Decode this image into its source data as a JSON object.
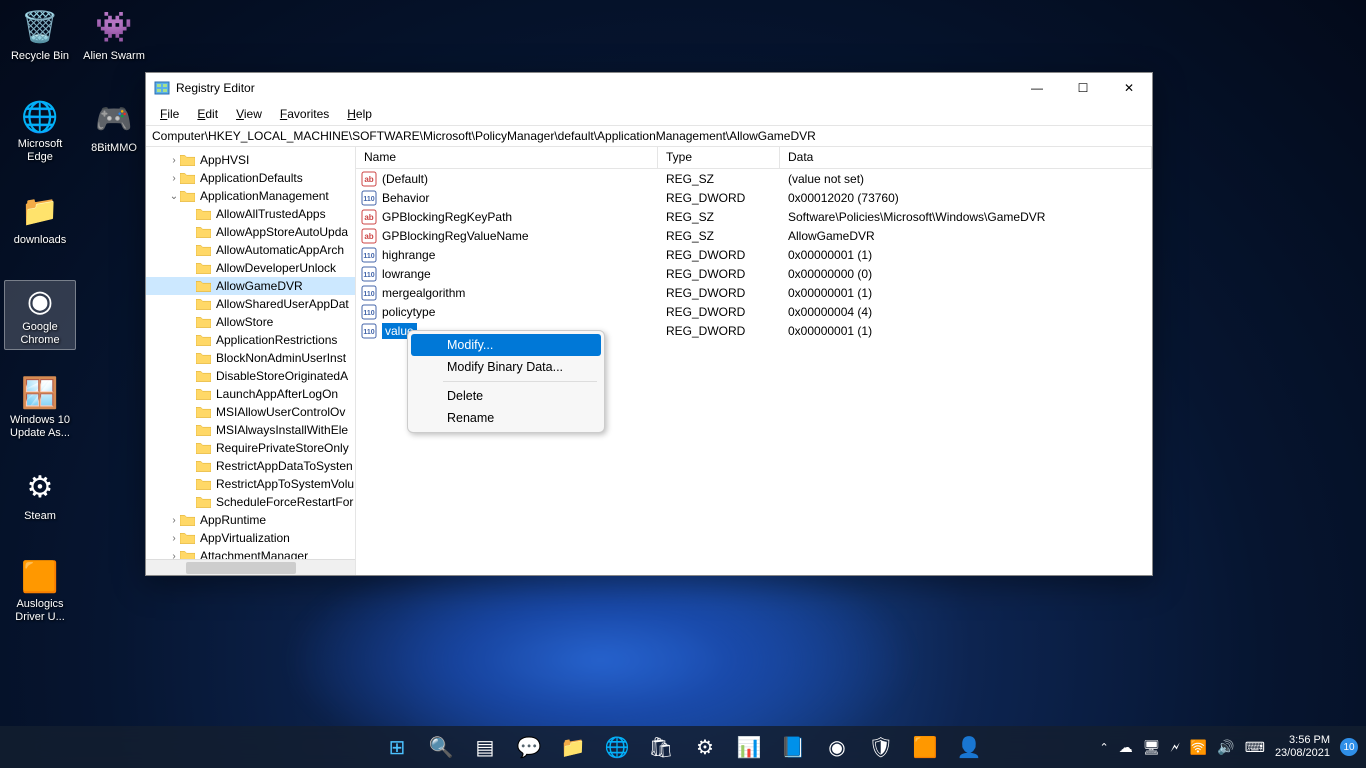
{
  "desktop": {
    "col1": [
      {
        "name": "recycle-bin",
        "label": "Recycle Bin",
        "glyph": "🗑️"
      },
      {
        "name": "edge",
        "label": "Microsoft Edge",
        "glyph": "🌐"
      },
      {
        "name": "downloads",
        "label": "downloads",
        "glyph": "📁"
      },
      {
        "name": "chrome",
        "label": "Google Chrome",
        "glyph": "◉",
        "selected": true
      },
      {
        "name": "win10update",
        "label": "Windows 10 Update As...",
        "glyph": "🪟"
      },
      {
        "name": "steam",
        "label": "Steam",
        "glyph": "⚙"
      },
      {
        "name": "auslogics",
        "label": "Auslogics Driver U...",
        "glyph": "🟧"
      }
    ],
    "col2": [
      {
        "name": "alien-swarm",
        "label": "Alien Swarm",
        "glyph": "👾"
      },
      {
        "name": "8bitmmo",
        "label": "8BitMMO",
        "glyph": "🎮"
      }
    ]
  },
  "window": {
    "title": "Registry Editor",
    "menu": [
      "File",
      "Edit",
      "View",
      "Favorites",
      "Help"
    ],
    "address": "Computer\\HKEY_LOCAL_MACHINE\\SOFTWARE\\Microsoft\\PolicyManager\\default\\ApplicationManagement\\AllowGameDVR",
    "tree": [
      {
        "indent": 1,
        "exp": ">",
        "label": "AppHVSI"
      },
      {
        "indent": 1,
        "exp": ">",
        "label": "ApplicationDefaults"
      },
      {
        "indent": 1,
        "exp": "v",
        "label": "ApplicationManagement"
      },
      {
        "indent": 2,
        "exp": "",
        "label": "AllowAllTrustedApps"
      },
      {
        "indent": 2,
        "exp": "",
        "label": "AllowAppStoreAutoUpda"
      },
      {
        "indent": 2,
        "exp": "",
        "label": "AllowAutomaticAppArch"
      },
      {
        "indent": 2,
        "exp": "",
        "label": "AllowDeveloperUnlock"
      },
      {
        "indent": 2,
        "exp": "",
        "label": "AllowGameDVR",
        "selected": true
      },
      {
        "indent": 2,
        "exp": "",
        "label": "AllowSharedUserAppDat"
      },
      {
        "indent": 2,
        "exp": "",
        "label": "AllowStore"
      },
      {
        "indent": 2,
        "exp": "",
        "label": "ApplicationRestrictions"
      },
      {
        "indent": 2,
        "exp": "",
        "label": "BlockNonAdminUserInst"
      },
      {
        "indent": 2,
        "exp": "",
        "label": "DisableStoreOriginatedA"
      },
      {
        "indent": 2,
        "exp": "",
        "label": "LaunchAppAfterLogOn"
      },
      {
        "indent": 2,
        "exp": "",
        "label": "MSIAllowUserControlOv"
      },
      {
        "indent": 2,
        "exp": "",
        "label": "MSIAlwaysInstallWithEle"
      },
      {
        "indent": 2,
        "exp": "",
        "label": "RequirePrivateStoreOnly"
      },
      {
        "indent": 2,
        "exp": "",
        "label": "RestrictAppDataToSysten"
      },
      {
        "indent": 2,
        "exp": "",
        "label": "RestrictAppToSystemVolu"
      },
      {
        "indent": 2,
        "exp": "",
        "label": "ScheduleForceRestartFor"
      },
      {
        "indent": 1,
        "exp": ">",
        "label": "AppRuntime"
      },
      {
        "indent": 1,
        "exp": ">",
        "label": "AppVirtualization"
      },
      {
        "indent": 1,
        "exp": ">",
        "label": "AttachmentManager"
      }
    ],
    "columns": {
      "name": "Name",
      "type": "Type",
      "data": "Data"
    },
    "values": [
      {
        "icon": "sz",
        "name": "(Default)",
        "type": "REG_SZ",
        "data": "(value not set)"
      },
      {
        "icon": "dw",
        "name": "Behavior",
        "type": "REG_DWORD",
        "data": "0x00012020 (73760)"
      },
      {
        "icon": "sz",
        "name": "GPBlockingRegKeyPath",
        "type": "REG_SZ",
        "data": "Software\\Policies\\Microsoft\\Windows\\GameDVR"
      },
      {
        "icon": "sz",
        "name": "GPBlockingRegValueName",
        "type": "REG_SZ",
        "data": "AllowGameDVR"
      },
      {
        "icon": "dw",
        "name": "highrange",
        "type": "REG_DWORD",
        "data": "0x00000001 (1)"
      },
      {
        "icon": "dw",
        "name": "lowrange",
        "type": "REG_DWORD",
        "data": "0x00000000 (0)"
      },
      {
        "icon": "dw",
        "name": "mergealgorithm",
        "type": "REG_DWORD",
        "data": "0x00000001 (1)"
      },
      {
        "icon": "dw",
        "name": "policytype",
        "type": "REG_DWORD",
        "data": "0x00000004 (4)"
      },
      {
        "icon": "dw",
        "name": "value",
        "type": "REG_DWORD",
        "data": "0x00000001 (1)",
        "selected": true
      }
    ],
    "context": {
      "items": [
        {
          "label": "Modify...",
          "highlight": true
        },
        {
          "label": "Modify Binary Data..."
        },
        {
          "sep": true
        },
        {
          "label": "Delete"
        },
        {
          "label": "Rename"
        }
      ]
    }
  },
  "taskbar": {
    "center": [
      {
        "name": "start",
        "glyph": "⊞",
        "color": "#4cc2ff"
      },
      {
        "name": "search",
        "glyph": "🔍"
      },
      {
        "name": "taskview",
        "glyph": "▤"
      },
      {
        "name": "chat",
        "glyph": "💬"
      },
      {
        "name": "explorer",
        "glyph": "📁"
      },
      {
        "name": "edge",
        "glyph": "🌐"
      },
      {
        "name": "store",
        "glyph": "🛍"
      },
      {
        "name": "settings",
        "glyph": "⚙"
      },
      {
        "name": "app1",
        "glyph": "📊"
      },
      {
        "name": "word",
        "glyph": "📘"
      },
      {
        "name": "chrome",
        "glyph": "◉"
      },
      {
        "name": "security",
        "glyph": "🛡"
      },
      {
        "name": "app2",
        "glyph": "🟧"
      },
      {
        "name": "app3",
        "glyph": "👤"
      }
    ],
    "tray": {
      "chevron": "⌃",
      "icons": [
        "☁",
        "🖥",
        "🗲",
        "🛜",
        "🔊",
        "⌨"
      ],
      "time": "3:56 PM",
      "date": "23/08/2021",
      "notif": "10"
    }
  }
}
